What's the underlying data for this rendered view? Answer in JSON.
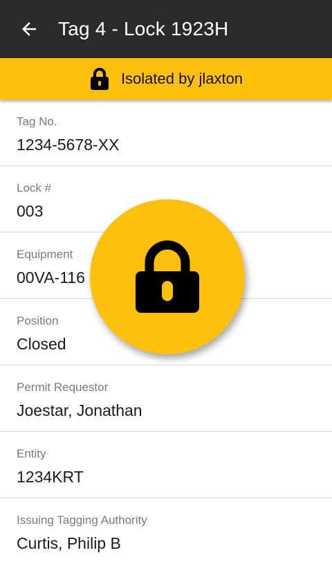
{
  "header": {
    "title": "Tag 4 - Lock 1923H",
    "back_icon": "arrow-back-icon",
    "background": "#2a2a2a"
  },
  "banner": {
    "text": "Isolated by jlaxton",
    "icon": "lock-icon",
    "color": "#fdc00f"
  },
  "fields": [
    {
      "label": "Tag No.",
      "value": "1234-5678-XX"
    },
    {
      "label": "Lock #",
      "value": "003"
    },
    {
      "label": "Equipment",
      "value": "00VA-116"
    },
    {
      "label": "Position",
      "value": "Closed"
    },
    {
      "label": "Permit Requestor",
      "value": "Joestar, Jonathan"
    },
    {
      "label": "Entity",
      "value": "1234KRT"
    },
    {
      "label": "Issuing Tagging Authority",
      "value": "Curtis, Philip B"
    }
  ],
  "lock_button": {
    "icon": "lock-icon",
    "color": "#fdc00f"
  }
}
